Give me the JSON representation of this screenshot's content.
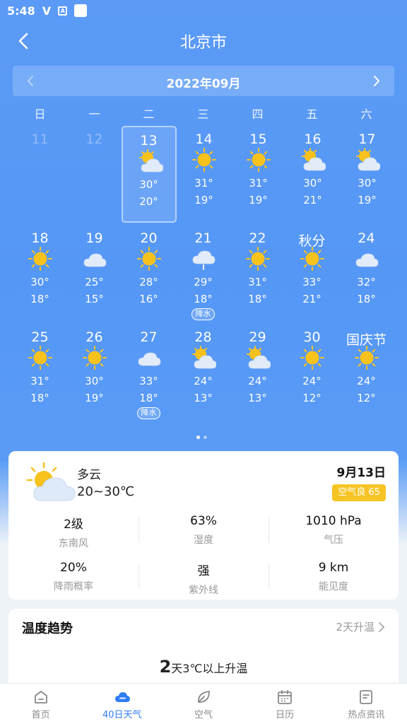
{
  "status_bar": {
    "time": "5:48"
  },
  "header": {
    "title": "北京市"
  },
  "month_nav": {
    "label": "2022年09月"
  },
  "weekdays": [
    "日",
    "一",
    "二",
    "三",
    "四",
    "五",
    "六"
  ],
  "calendar": {
    "weeks": [
      [
        {
          "day": "11",
          "past": true
        },
        {
          "day": "12",
          "past": true
        },
        {
          "day": "13",
          "icon": "partly-cloudy-icon",
          "hi": "30°",
          "lo": "20°",
          "selected": true
        },
        {
          "day": "14",
          "icon": "sunny-icon",
          "hi": "31°",
          "lo": "19°"
        },
        {
          "day": "15",
          "icon": "sunny-icon",
          "hi": "31°",
          "lo": "19°"
        },
        {
          "day": "16",
          "icon": "partly-cloudy-icon",
          "hi": "30°",
          "lo": "21°"
        },
        {
          "day": "17",
          "icon": "partly-cloudy-icon",
          "hi": "30°",
          "lo": "19°"
        }
      ],
      [
        {
          "day": "18",
          "icon": "sunny-icon",
          "hi": "30°",
          "lo": "18°"
        },
        {
          "day": "19",
          "icon": "cloudy-icon",
          "hi": "25°",
          "lo": "15°"
        },
        {
          "day": "20",
          "icon": "sunny-icon",
          "hi": "28°",
          "lo": "16°"
        },
        {
          "day": "21",
          "icon": "light-rain-icon",
          "hi": "29°",
          "lo": "18°",
          "rain": "降水"
        },
        {
          "day": "22",
          "icon": "sunny-icon",
          "hi": "31°",
          "lo": "18°"
        },
        {
          "day": "秋分",
          "icon": "sunny-icon",
          "hi": "33°",
          "lo": "21°"
        },
        {
          "day": "24",
          "icon": "cloudy-icon",
          "hi": "32°",
          "lo": "18°"
        }
      ],
      [
        {
          "day": "25",
          "icon": "sunny-icon",
          "hi": "31°",
          "lo": "18°"
        },
        {
          "day": "26",
          "icon": "sunny-icon",
          "hi": "30°",
          "lo": "19°"
        },
        {
          "day": "27",
          "icon": "cloudy-icon",
          "hi": "33°",
          "lo": "18°",
          "rain": "降水"
        },
        {
          "day": "28",
          "icon": "partly-cloudy-icon",
          "hi": "24°",
          "lo": "13°"
        },
        {
          "day": "29",
          "icon": "partly-cloudy-icon",
          "hi": "24°",
          "lo": "13°"
        },
        {
          "day": "30",
          "icon": "sunny-icon",
          "hi": "24°",
          "lo": "12°"
        },
        {
          "day": "国庆节",
          "icon": "sunny-icon",
          "hi": "24°",
          "lo": "12°"
        }
      ]
    ]
  },
  "today": {
    "icon": "partly-cloudy-icon",
    "condition": "多云",
    "range": "20~30℃",
    "date": "9月13日",
    "aqi": "空气良 65",
    "metrics": [
      {
        "value": "2级",
        "label": "东南风"
      },
      {
        "value": "63%",
        "label": "湿度"
      },
      {
        "value": "1010 hPa",
        "label": "气压"
      },
      {
        "value": "20%",
        "label": "降雨概率"
      },
      {
        "value": "强",
        "label": "紫外线"
      },
      {
        "value": "9 km",
        "label": "能见度"
      }
    ]
  },
  "trend": {
    "title": "温度趋势",
    "link": "2天升温",
    "summary_num": "2",
    "summary_text": "天3℃以上升温"
  },
  "tabs": [
    {
      "label": "首页",
      "icon": "home-icon"
    },
    {
      "label": "40日天气",
      "icon": "cloud-icon",
      "active": true
    },
    {
      "label": "空气",
      "icon": "leaf-icon"
    },
    {
      "label": "日历",
      "icon": "calendar-icon"
    },
    {
      "label": "热点资讯",
      "icon": "news-icon"
    }
  ],
  "colors": {
    "accent": "#2f7df5",
    "aqi_badge": "#f6c425",
    "sun": "#f8c21c",
    "cloud": "#dfeaf8"
  }
}
